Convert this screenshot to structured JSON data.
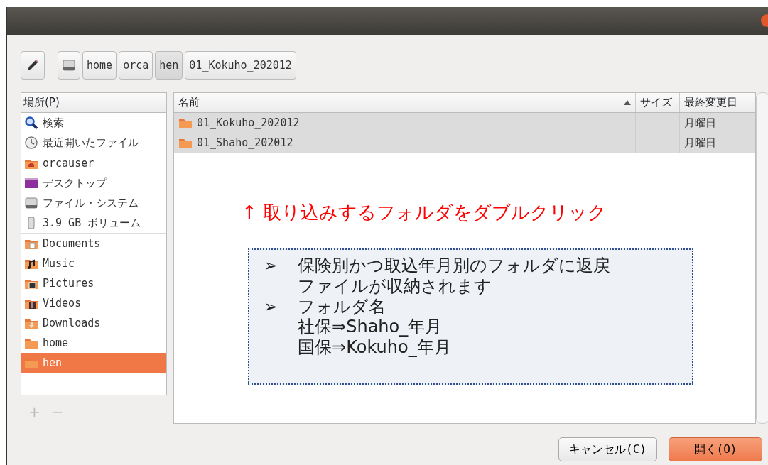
{
  "path_bar": {
    "crumbs": [
      {
        "kind": "drive",
        "selected": false
      },
      {
        "kind": "text",
        "label": "home",
        "selected": false
      },
      {
        "kind": "text",
        "label": "orca",
        "selected": false
      },
      {
        "kind": "text",
        "label": "hen",
        "selected": true
      },
      {
        "kind": "text",
        "label": "01_Kokuho_202012",
        "selected": false
      }
    ]
  },
  "places": {
    "header": "場所(P)",
    "groups": [
      [
        {
          "kind": "search",
          "label": "検索",
          "selected": false
        },
        {
          "kind": "recent",
          "label": "最近開いたファイル",
          "selected": false
        }
      ],
      [
        {
          "kind": "home",
          "label": "orcauser",
          "selected": false
        },
        {
          "kind": "desktop",
          "label": "デスクトップ",
          "selected": false
        },
        {
          "kind": "filesystem",
          "label": "ファイル・システム",
          "selected": false
        },
        {
          "kind": "volume",
          "label": "3.9 GB ボリューム",
          "selected": false
        }
      ],
      [
        {
          "kind": "documents",
          "label": "Documents",
          "selected": false
        },
        {
          "kind": "music",
          "label": "Music",
          "selected": false
        },
        {
          "kind": "pictures",
          "label": "Pictures",
          "selected": false
        },
        {
          "kind": "videos",
          "label": "Videos",
          "selected": false
        },
        {
          "kind": "downloads",
          "label": "Downloads",
          "selected": false
        },
        {
          "kind": "bookmark",
          "label": "home",
          "selected": false
        },
        {
          "kind": "bookmark",
          "label": "hen",
          "selected": true
        }
      ]
    ],
    "add": "+",
    "remove": "−"
  },
  "file_list": {
    "columns": [
      {
        "label": "名前",
        "sorted": true
      },
      {
        "label": "サイズ",
        "sorted": false
      },
      {
        "label": "最終変更日",
        "sorted": false
      }
    ],
    "rows": [
      {
        "name": "01_Kokuho_202012",
        "modified": "月曜日",
        "selected": true
      },
      {
        "name": "01_Shaho_202012",
        "modified": "月曜日",
        "selected": true
      }
    ]
  },
  "annotation": {
    "headline": "↑ 取り込みするフォルダをダブルクリック",
    "notes": [
      {
        "bullet": "➢",
        "lines": [
          "保険別かつ取込年月別のフォルダに返戻",
          "ファイルが収納されます"
        ]
      },
      {
        "bullet": "➢",
        "lines": [
          "フォルダ名",
          "社保⇒Shaho_年月",
          "国保⇒Kokuho_年月"
        ]
      }
    ]
  },
  "buttons": [
    {
      "kind": "cancel",
      "label": "キャンセル(C)"
    },
    {
      "kind": "default",
      "label": "開く(O)"
    }
  ]
}
